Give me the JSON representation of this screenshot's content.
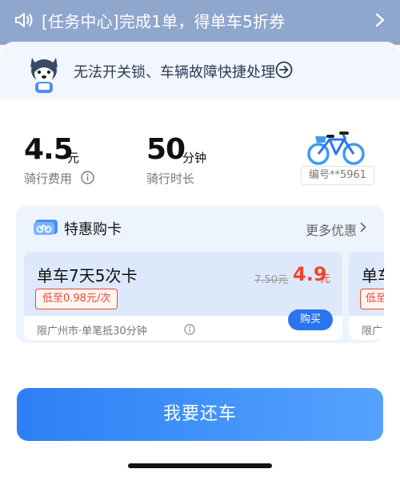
{
  "banner": {
    "message": "[任务中心]完成1单，得单车5折券",
    "speaker_icon": "speaker-icon",
    "chevron_icon": "chevron-right-icon"
  },
  "notice": {
    "text": "无法开关锁、车辆故障快捷处理",
    "mascot_icon": "husky-mascot-icon",
    "arrow_icon": "circle-arrow-right-icon"
  },
  "ride": {
    "fee_value": "4.5",
    "fee_unit": "元",
    "fee_label": "骑行费用",
    "duration_value": "50",
    "duration_unit": "分钟",
    "duration_label": "骑行时长",
    "bike_id": "编号**5961",
    "bike_icon": "bicycle-icon"
  },
  "deals": {
    "title": "特惠购卡",
    "more_label": "更多优惠",
    "card_icon": "bike-card-icon",
    "cards": [
      {
        "name": "单车7天5次卡",
        "original_price": "7.50元",
        "sale_price": "4.9",
        "sale_unit": "元",
        "low_tag": "低至0.98元/次",
        "buy_label": "购买",
        "note": "限广州市·单笔抵30分钟"
      },
      {
        "name": "单车",
        "low_tag": "低至",
        "note": "限广"
      }
    ]
  },
  "actions": {
    "return_label": "我要还车"
  },
  "colors": {
    "banner_bg": "#8fa6cd",
    "accent_blue": "#2a74f0",
    "price_red": "#f0452b"
  }
}
